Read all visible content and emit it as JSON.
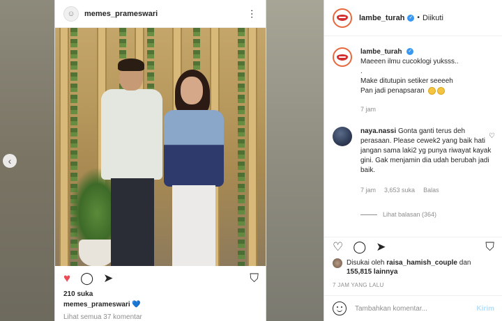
{
  "left_post": {
    "username": "memes_prameswari",
    "likes": "210 suka",
    "caption_user": "memes_prameswari",
    "caption_emoji": "💙",
    "view_comments": "Lihat semua 37 komentar"
  },
  "panel": {
    "header": {
      "username": "lambe_turah",
      "separator": "•",
      "follow_status": "Diikuti"
    },
    "caption": {
      "username": "lambe_turah",
      "text": "Maeeen ilmu cucoklogi yuksss..\n.\nMake ditutupin setiker seeeeh\nPan jadi penapsaran",
      "time": "7 jam"
    },
    "comment": {
      "username": "naya.nassi",
      "text": "Gonta ganti terus deh perasaan. Please cewek2 yang baik hati jangan sama laki2 yg punya riwayat kayak gini. Gak menjamin dia udah berubah jadi baik.",
      "time": "7 jam",
      "likes": "3,653 suka",
      "reply": "Balas",
      "view_replies": "Lihat balasan (364)"
    },
    "liked_by": {
      "prefix": "Disukai oleh",
      "user": "raisa_hamish_couple",
      "middle": "dan",
      "others": "155,815 lainnya"
    },
    "posted_time": "7 JAM YANG LALU",
    "comment_box": {
      "placeholder": "Tambahkan komentar...",
      "post_label": "Kirim"
    }
  },
  "icons": {
    "heart": "heart-icon",
    "comment": "comment-icon",
    "share": "share-icon",
    "bookmark": "bookmark-icon",
    "more": "more-options-icon",
    "verified": "verified-badge-icon",
    "emoji": "emoji-icon",
    "nav_prev": "chevron-left-icon"
  },
  "colors": {
    "accent": "#3897f0",
    "like_red": "#ed4956",
    "muted": "#8e8e8e"
  }
}
